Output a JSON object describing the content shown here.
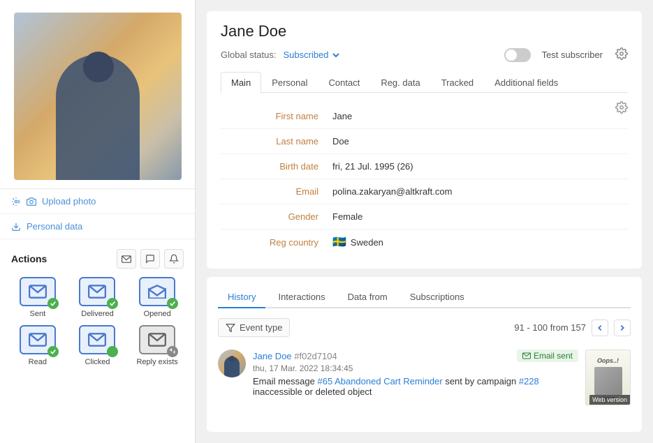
{
  "left": {
    "upload_photo": "Upload photo",
    "personal_data": "Personal data",
    "actions_title": "Actions",
    "action_items": [
      {
        "label": "Sent",
        "badge_color": "#4CAF50",
        "badge_symbol": "✓"
      },
      {
        "label": "Delivered",
        "badge_color": "#4CAF50",
        "badge_symbol": "✓"
      },
      {
        "label": "Opened",
        "badge_color": "#4CAF50",
        "badge_symbol": "✓"
      },
      {
        "label": "Read",
        "badge_color": "#4CAF50",
        "badge_symbol": "✓"
      },
      {
        "label": "Clicked",
        "badge_color": "#4CAF50",
        "badge_symbol": "✓"
      },
      {
        "label": "Reply exists",
        "badge_color": "#888",
        "badge_symbol": "↩"
      }
    ]
  },
  "profile": {
    "name": "Jane Doe",
    "global_status_label": "Global status:",
    "status_value": "Subscribed",
    "toggle_label": "Test subscriber",
    "tabs": [
      {
        "id": "main",
        "label": "Main",
        "active": true
      },
      {
        "id": "personal",
        "label": "Personal",
        "active": false
      },
      {
        "id": "contact",
        "label": "Contact",
        "active": false
      },
      {
        "id": "reg_data",
        "label": "Reg. data",
        "active": false
      },
      {
        "id": "tracked",
        "label": "Tracked",
        "active": false
      },
      {
        "id": "additional_fields",
        "label": "Additional fields",
        "active": false
      }
    ],
    "fields": [
      {
        "label": "First name",
        "value": "Jane"
      },
      {
        "label": "Last name",
        "value": "Doe"
      },
      {
        "label": "Birth date",
        "value": "fri, 21 Jul. 1995 (26)"
      },
      {
        "label": "Email",
        "value": "polina.zakaryan@altkraft.com"
      },
      {
        "label": "Gender",
        "value": "Female"
      },
      {
        "label": "Reg country",
        "value": "Sweden",
        "flag": "🇸🇪"
      }
    ]
  },
  "history_section": {
    "tabs": [
      {
        "id": "history",
        "label": "History",
        "active": true
      },
      {
        "id": "interactions",
        "label": "Interactions",
        "active": false
      },
      {
        "id": "data_from",
        "label": "Data from",
        "active": false
      },
      {
        "id": "subscriptions",
        "label": "Subscriptions",
        "active": false
      }
    ],
    "filter_label": "Event type",
    "pagination": "91 - 100 from 157",
    "event": {
      "user_name": "Jane Doe",
      "user_id": "#f02d7104",
      "date": "thu, 17 Mar. 2022 18:34:45",
      "badge_label": "Email sent",
      "description_pre": "Email message ",
      "link1_label": "#65 Abandoned Cart Reminder",
      "description_mid": " sent by campaign ",
      "link2_label": "#228",
      "description_post": " inaccessible or deleted object",
      "thumbnail_oops": "Oops..!",
      "web_version": "Web version"
    }
  }
}
